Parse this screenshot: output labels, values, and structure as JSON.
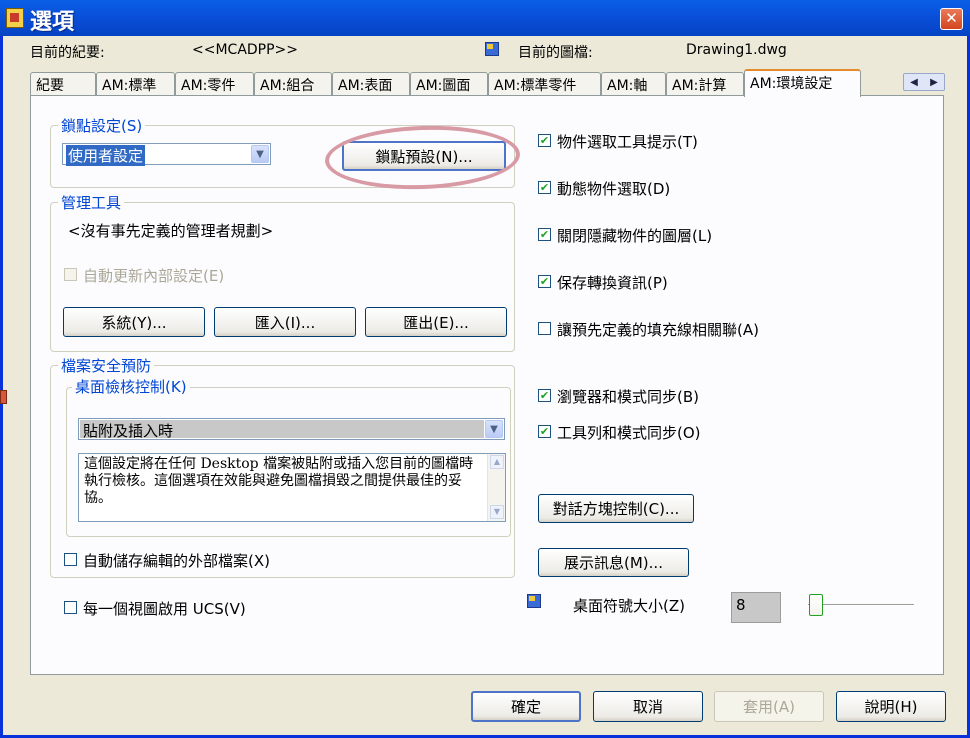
{
  "window": {
    "title": "選項",
    "close_glyph": "✕"
  },
  "header": {
    "profile_label": "目前的紀要:",
    "profile_value": "<<MCADPP>>",
    "drawing_label": "目前的圖檔:",
    "drawing_value": "Drawing1.dwg"
  },
  "tabs": [
    {
      "label": "紀要"
    },
    {
      "label": "AM:標準"
    },
    {
      "label": "AM:零件"
    },
    {
      "label": "AM:組合"
    },
    {
      "label": "AM:表面"
    },
    {
      "label": "AM:圖面"
    },
    {
      "label": "AM:標準零件"
    },
    {
      "label": "AM:軸"
    },
    {
      "label": "AM:計算"
    },
    {
      "label": "AM:環境設定"
    }
  ],
  "tab_scroll": {
    "left": "◀",
    "right": "▶"
  },
  "lock": {
    "legend": "鎖點設定(S)",
    "combo_value": "使用者設定",
    "preset_button": "鎖點預設(N)..."
  },
  "admin": {
    "legend": "管理工具",
    "no_rules_text": "<沒有事先定義的管理者規劃>",
    "auto_update_label": "自動更新內部設定(E)",
    "system_button": "系統(Y)...",
    "import_button": "匯入(I)...",
    "export_button": "匯出(E)..."
  },
  "security": {
    "legend": "檔案安全預防",
    "desktop_legend": "桌面檢核控制(K)",
    "combo_value": "貼附及插入時",
    "description": "這個設定將在任何 Desktop 檔案被貼附或插入您目前的圖檔時執行檢核。這個選項在效能與避免圖檔損毀之間提供最佳的妥協。",
    "autosave_label": "自動儲存編輯的外部檔案(X)"
  },
  "ucs_label": "每一個視圖啟用 UCS(V)",
  "right_options": [
    {
      "label": "物件選取工具提示(T)",
      "checked": true
    },
    {
      "label": "動態物件選取(D)",
      "checked": true
    },
    {
      "label": "關閉隱藏物件的圖層(L)",
      "checked": true
    },
    {
      "label": "保存轉換資訊(P)",
      "checked": true
    },
    {
      "label": "讓預先定義的填充線相關聯(A)",
      "checked": false
    },
    {
      "label": "瀏覽器和模式同步(B)",
      "checked": true
    },
    {
      "label": "工具列和模式同步(O)",
      "checked": true
    }
  ],
  "dialog_control_button": "對話方塊控制(C)...",
  "show_messages_button": "展示訊息(M)...",
  "symbol_size": {
    "label": "桌面符號大小(Z)",
    "value": "8",
    "slider_level": 0
  },
  "footer": {
    "ok": "確定",
    "cancel": "取消",
    "apply": "套用(A)",
    "help": "說明(H)"
  },
  "check_glyph": "✔",
  "combo_arrow_glyph": "▼"
}
